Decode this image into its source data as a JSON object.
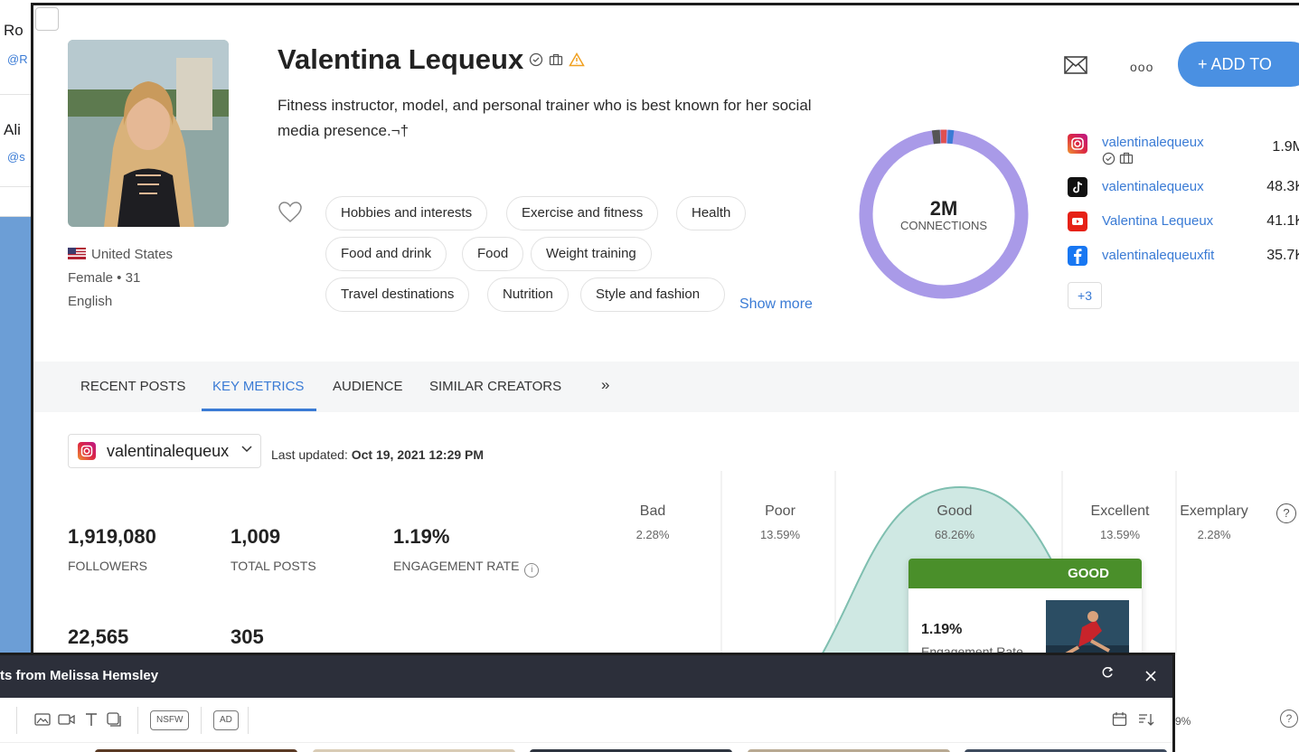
{
  "background_list": {
    "items": [
      {
        "name": "Ro",
        "handle": "@R"
      },
      {
        "name": "Ali",
        "handle": "@s"
      }
    ]
  },
  "profile": {
    "name": "Valentina Lequeux",
    "bio": "Fitness instructor, model, and personal trainer who is best known for her social media presence.¬†",
    "country": "United States",
    "gender_age": "Female  •  31",
    "language": "English",
    "tags": [
      "Hobbies and interests",
      "Exercise and fitness",
      "Health",
      "Food and drink",
      "Food",
      "Weight training",
      "Travel destinations",
      "Nutrition",
      "Style and fashion"
    ],
    "show_more": "Show more",
    "connections_value": "2M",
    "connections_label": "CONNECTIONS"
  },
  "actions": {
    "add_button": "+  ADD TO",
    "more_label": "ooo"
  },
  "socials": [
    {
      "platform": "instagram",
      "handle": "valentinalequeux",
      "count": "1.9M",
      "color": "#d6249f"
    },
    {
      "platform": "tiktok",
      "handle": "valentinalequeux",
      "count": "48.3K",
      "color": "#111111"
    },
    {
      "platform": "youtube",
      "handle": "Valentina Lequeux",
      "count": "41.1K",
      "color": "#e62117"
    },
    {
      "platform": "facebook",
      "handle": "valentinalequeuxfit",
      "count": "35.7K",
      "color": "#1877f2"
    }
  ],
  "socials_more": "+3",
  "tabs": [
    "RECENT POSTS",
    "KEY METRICS",
    "AUDIENCE",
    "SIMILAR CREATORS"
  ],
  "tabs_more": "»",
  "metrics_header": {
    "account": "valentinalequeux",
    "updated_label": "Last updated:",
    "updated_value": "Oct 19, 2021 12:29 PM"
  },
  "metrics": [
    {
      "value": "1,919,080",
      "label": "FOLLOWERS"
    },
    {
      "value": "1,009",
      "label": "TOTAL POSTS"
    },
    {
      "value": "1.19%",
      "label": "ENGAGEMENT RATE"
    },
    {
      "value": "22,565",
      "label": ""
    },
    {
      "value": "305",
      "label": ""
    }
  ],
  "distribution": [
    {
      "name": "Bad",
      "pct": "2.28%"
    },
    {
      "name": "Poor",
      "pct": "13.59%"
    },
    {
      "name": "Good",
      "pct": "68.26%"
    },
    {
      "name": "Excellent",
      "pct": "13.59%"
    },
    {
      "name": "Exemplary",
      "pct": "2.28%"
    }
  ],
  "good_card": {
    "header": "GOOD",
    "value": "1.19%",
    "label": "Engagement Rate"
  },
  "posts_window": {
    "title": "ts from Melissa Hemsley",
    "nsfw": "NSFW",
    "ad": "AD",
    "tail_pct": "9%"
  },
  "colors": {
    "accent": "#4a90e2",
    "good_green": "#4a8f2a",
    "donut": "#a99ae8",
    "curve_fill": "#cfe8e3"
  }
}
